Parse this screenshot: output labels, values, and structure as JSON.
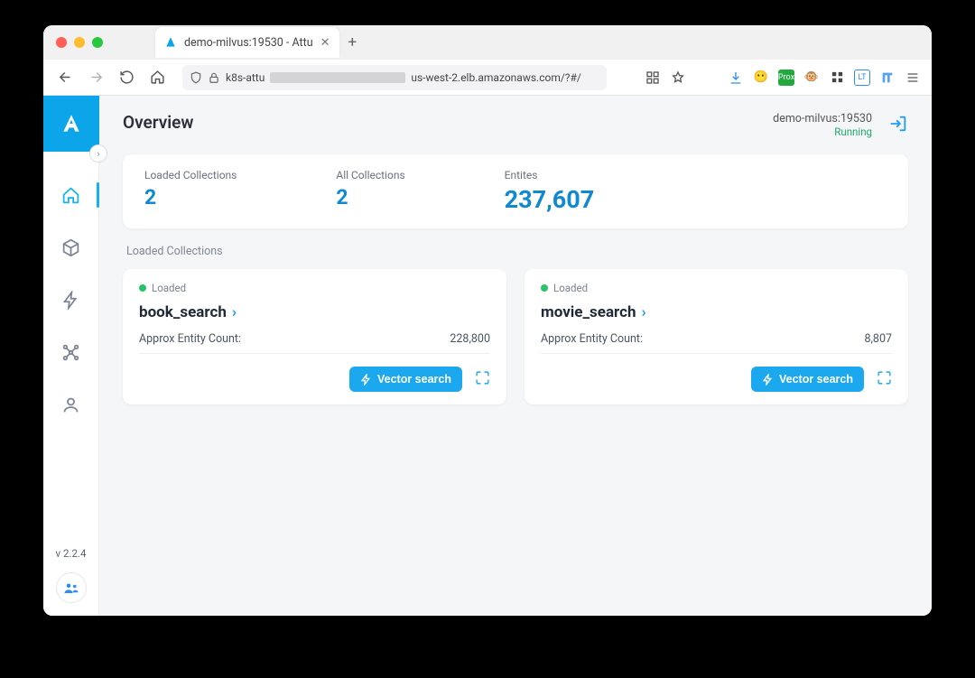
{
  "browser": {
    "tab_title": "demo-milvus:19530 - Attu",
    "url_prefix": "k8s-attu",
    "url_suffix": "us-west-2.elb.amazonaws.com/?#/"
  },
  "page": {
    "title": "Overview",
    "connection": "demo-milvus:19530",
    "status": "Running"
  },
  "stats": {
    "loaded_label": "Loaded Collections",
    "loaded_value": "2",
    "all_label": "All Collections",
    "all_value": "2",
    "entities_label": "Entites",
    "entities_value": "237,607"
  },
  "loaded_section_label": "Loaded Collections",
  "vector_search_label": "Vector search",
  "approx_label": "Approx Entity Count:",
  "loaded_badge": "Loaded",
  "collections": [
    {
      "name": "book_search",
      "count": "228,800"
    },
    {
      "name": "movie_search",
      "count": "8,807"
    }
  ],
  "version": "v 2.2.4"
}
